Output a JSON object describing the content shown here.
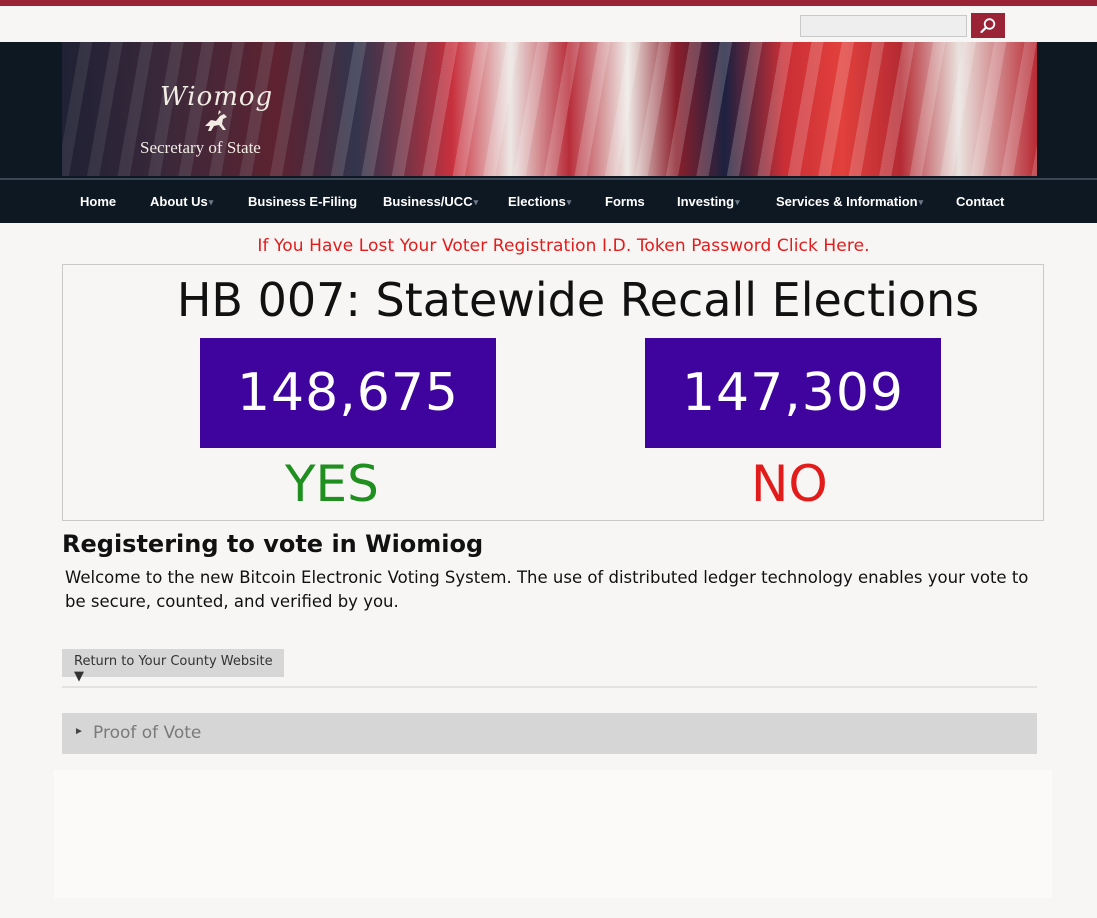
{
  "header": {
    "search": {
      "value": "",
      "placeholder": ""
    },
    "search_icon": "magnifier-icon",
    "logo": {
      "script": "Wiomog",
      "subtitle": "Secretary of State"
    }
  },
  "nav": {
    "items": [
      {
        "label": "Home",
        "dropdown": false
      },
      {
        "label": "About Us",
        "dropdown": true
      },
      {
        "label": "Business E-Filing",
        "dropdown": false
      },
      {
        "label": "Business/UCC",
        "dropdown": true
      },
      {
        "label": "Elections",
        "dropdown": true
      },
      {
        "label": "Forms",
        "dropdown": false
      },
      {
        "label": "Investing",
        "dropdown": true
      },
      {
        "label": "Services & Information",
        "dropdown": true
      },
      {
        "label": "Contact",
        "dropdown": false
      }
    ],
    "caret": "▾"
  },
  "alert": {
    "text": "If You Have Lost Your Voter Registration I.D. Token Password Click Here."
  },
  "results": {
    "title": "HB 007: Statewide Recall Elections",
    "yes": {
      "count": "148,675",
      "label": "YES"
    },
    "no": {
      "count": "147,309",
      "label": "NO"
    }
  },
  "main": {
    "heading": "Registering to vote in Wiomiog",
    "intro": "Welcome to the new Bitcoin Electronic Voting System.  The use of distributed ledger technology enables your vote to be secure, counted, and verified by you.",
    "county_button": "Return to Your County Website ▼",
    "proof_arrow": "►",
    "proof_label": "Proof of Vote"
  },
  "colors": {
    "brand": "#9a2436",
    "nav_bg": "#0e1822",
    "count_box": "#3f039e",
    "yes": "#1f8f1f",
    "no": "#e21b1b"
  }
}
